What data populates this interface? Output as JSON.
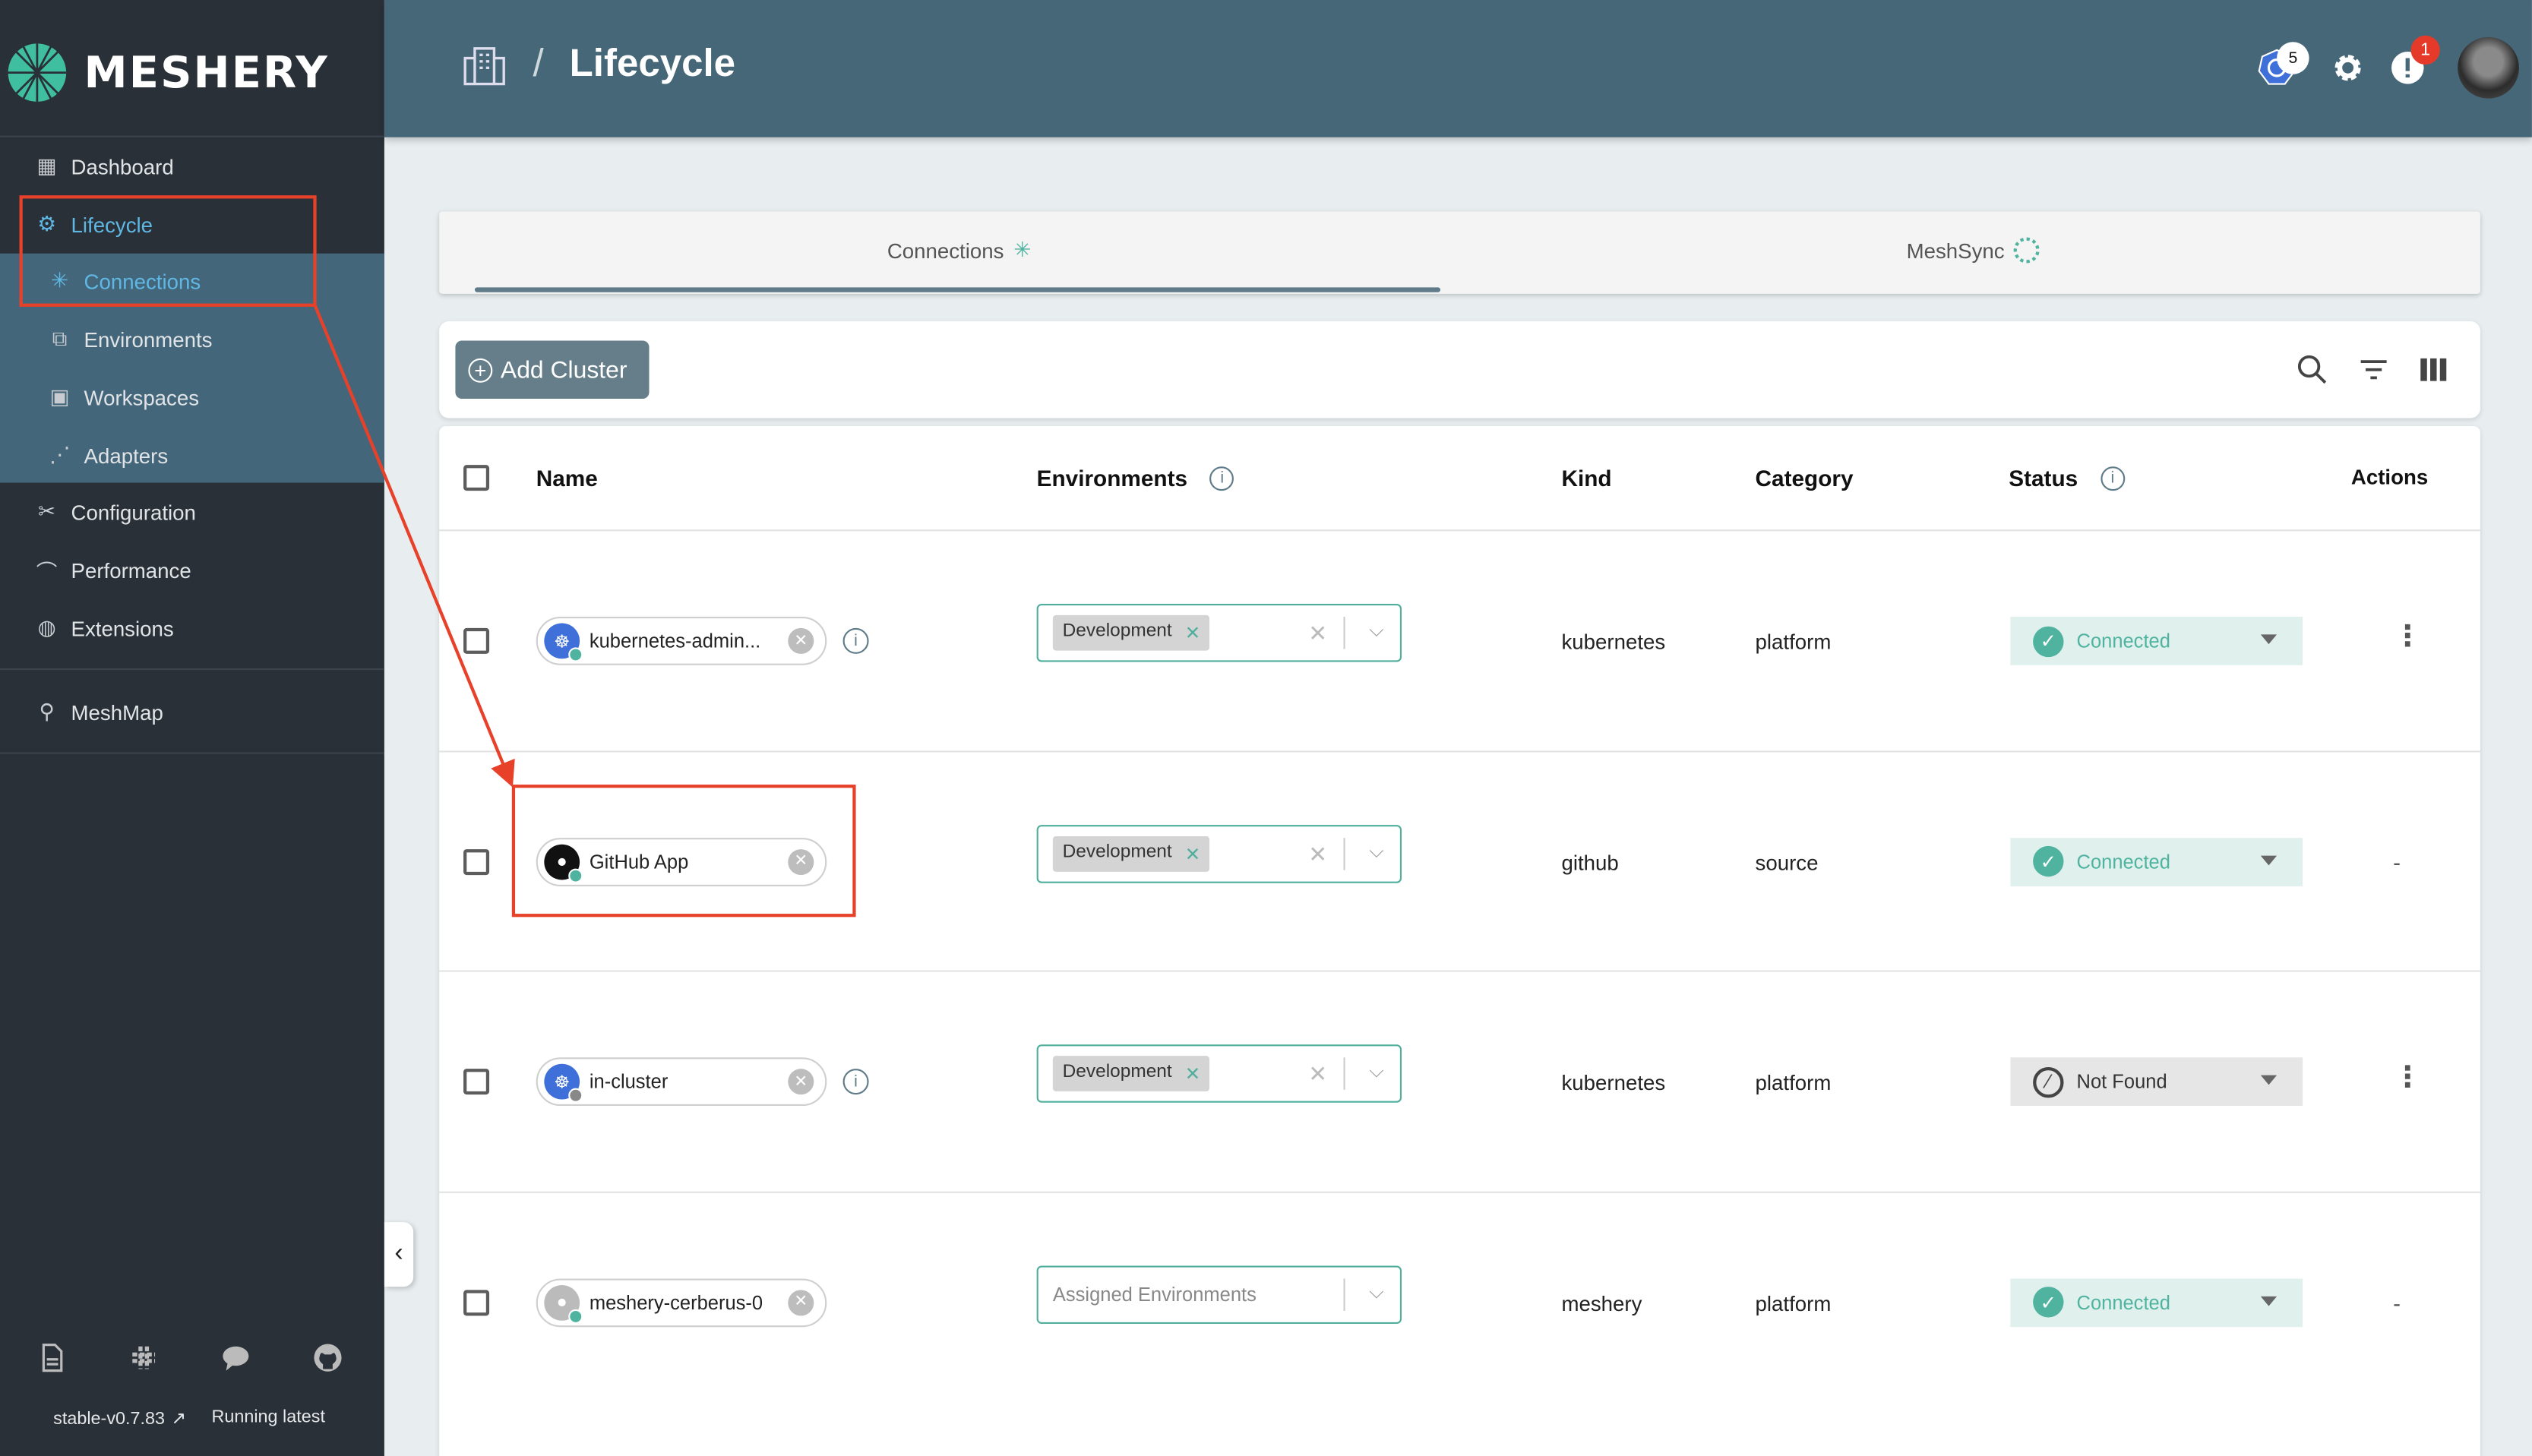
{
  "brand": {
    "name": "MESHERY",
    "accent": "#00b39f",
    "header_color": "#456778",
    "sidebar_color": "#2a3038"
  },
  "sidebar": {
    "items": [
      {
        "label": "Dashboard",
        "icon": "dashboard-icon"
      },
      {
        "label": "Lifecycle",
        "icon": "lifecycle-gears-icon",
        "active": true
      },
      {
        "label": "Connections",
        "icon": "connections-icon",
        "sub": true,
        "active": true
      },
      {
        "label": "Environments",
        "icon": "environments-icon",
        "sub": true
      },
      {
        "label": "Workspaces",
        "icon": "workspaces-icon",
        "sub": true
      },
      {
        "label": "Adapters",
        "icon": "adapters-icon",
        "sub": true
      },
      {
        "label": "Configuration",
        "icon": "configuration-icon"
      },
      {
        "label": "Performance",
        "icon": "performance-icon"
      },
      {
        "label": "Extensions",
        "icon": "extensions-icon"
      },
      {
        "label": "MeshMap",
        "icon": "meshmap-pin-icon"
      }
    ],
    "footer": {
      "icons": [
        "docs-icon",
        "slack-icon",
        "chat-icon",
        "github-icon"
      ],
      "version": "stable-v0.7.83",
      "status": "Running latest"
    }
  },
  "header": {
    "title": "Lifecycle",
    "separator": "/",
    "k8s_badge": "5",
    "alert_badge": "1"
  },
  "tabs": [
    {
      "label": "Connections",
      "active": true
    },
    {
      "label": "MeshSync"
    }
  ],
  "toolbar": {
    "add_label": "Add Cluster"
  },
  "table": {
    "headers": {
      "name": "Name",
      "environments": "Environments",
      "kind": "Kind",
      "category": "Category",
      "status": "Status",
      "actions": "Actions"
    },
    "rows": [
      {
        "name": "kubernetes-admin...",
        "icon": "kubernetes",
        "info": true,
        "env": "Development",
        "kind": "kubernetes",
        "category": "platform",
        "status": "Connected",
        "actions": "menu"
      },
      {
        "name": "GitHub App",
        "icon": "github",
        "info": false,
        "env": "Development",
        "kind": "github",
        "category": "source",
        "status": "Connected",
        "actions": "-"
      },
      {
        "name": "in-cluster",
        "icon": "kubernetes",
        "info": true,
        "env": "Development",
        "kind": "kubernetes",
        "category": "platform",
        "status": "Not Found",
        "actions": "menu"
      },
      {
        "name": "meshery-cerberus-0",
        "icon": "user",
        "info": false,
        "env": "",
        "env_placeholder": "Assigned Environments",
        "kind": "meshery",
        "category": "platform",
        "status": "Connected",
        "actions": "-"
      }
    ]
  },
  "status_colors": {
    "Connected": "#4fb3a0",
    "Not Found": "#333333"
  },
  "annotation_color": "#e8412a"
}
